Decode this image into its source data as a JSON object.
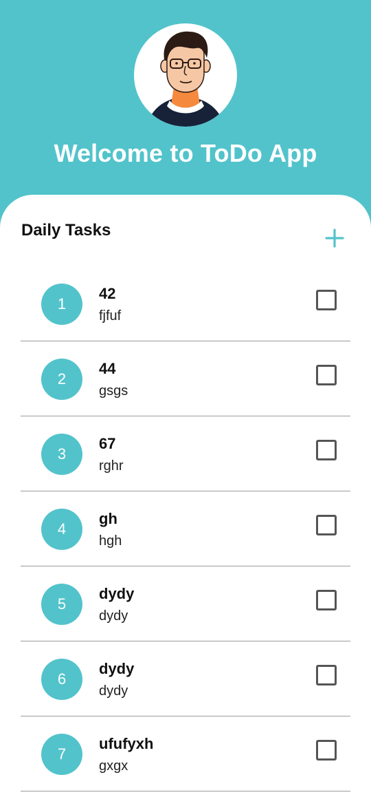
{
  "header": {
    "title": "Welcome to ToDo App"
  },
  "section": {
    "title": "Daily Tasks",
    "add_icon": "plus-icon"
  },
  "tasks": [
    {
      "number": "1",
      "title": "42",
      "description": "fjfuf",
      "checked": false
    },
    {
      "number": "2",
      "title": "44",
      "description": "gsgs",
      "checked": false
    },
    {
      "number": "3",
      "title": "67",
      "description": "rghr",
      "checked": false
    },
    {
      "number": "4",
      "title": "gh",
      "description": "hgh",
      "checked": false
    },
    {
      "number": "5",
      "title": "dydy",
      "description": "dydy",
      "checked": false
    },
    {
      "number": "6",
      "title": "dydy",
      "description": "dydy",
      "checked": false
    },
    {
      "number": "7",
      "title": "ufufyxh",
      "description": "gxgx",
      "checked": false
    }
  ],
  "colors": {
    "accent": "#52C3CB",
    "background": "#FFFFFF",
    "text": "#111111"
  }
}
